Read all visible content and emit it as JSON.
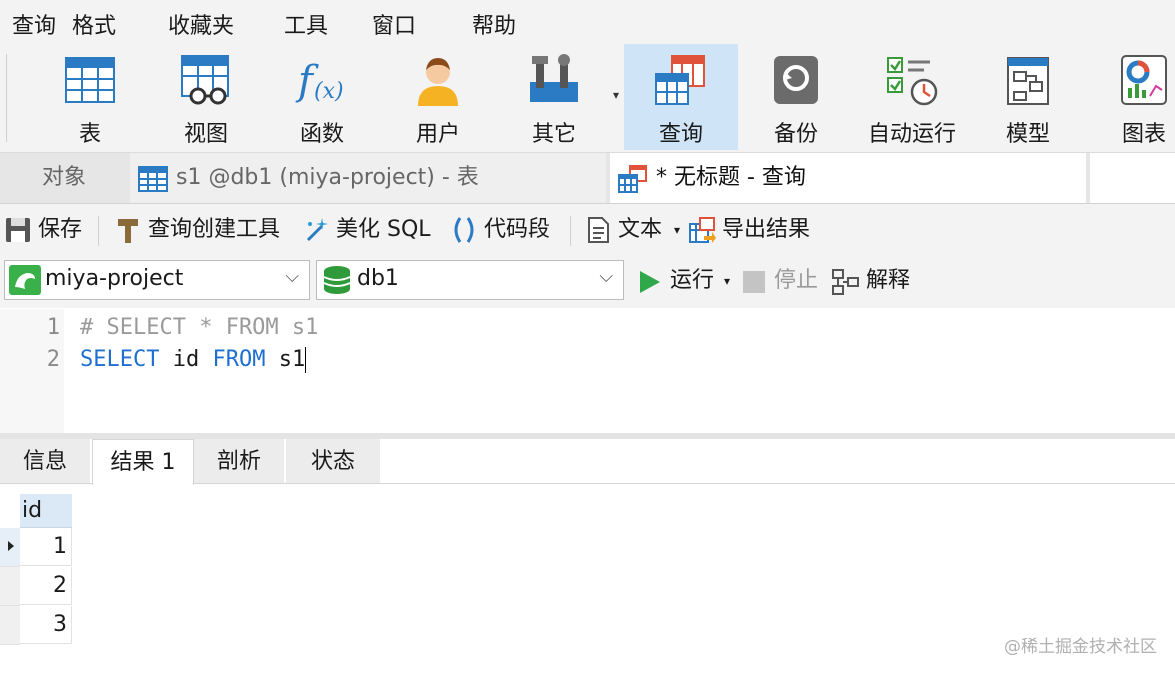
{
  "menu": [
    "查询",
    "格式",
    "收藏夹",
    "工具",
    "窗口",
    "帮助"
  ],
  "toolbar": {
    "buttons": [
      {
        "label": "表",
        "icon": "table-icon"
      },
      {
        "label": "视图",
        "icon": "view-icon"
      },
      {
        "label": "函数",
        "icon": "function-icon"
      },
      {
        "label": "用户",
        "icon": "user-icon"
      },
      {
        "label": "其它",
        "icon": "tools-icon"
      },
      {
        "label": "查询",
        "icon": "query-icon",
        "active": true
      },
      {
        "label": "备份",
        "icon": "backup-icon"
      },
      {
        "label": "自动运行",
        "icon": "autorun-icon"
      },
      {
        "label": "模型",
        "icon": "model-icon"
      },
      {
        "label": "图表",
        "icon": "chart-icon"
      }
    ]
  },
  "tabs": {
    "objects": "对象",
    "tab1": "s1 @db1 (miya-project) - 表",
    "tab2": "* 无标题 - 查询"
  },
  "query_toolbar": {
    "save": "保存",
    "query_builder": "查询创建工具",
    "beautify": "美化 SQL",
    "snippet": "代码段",
    "text": "文本",
    "export": "导出结果"
  },
  "selectors": {
    "connection": "miya-project",
    "database": "db1",
    "run": "运行",
    "stop": "停止",
    "explain": "解释"
  },
  "editor": {
    "lines": [
      {
        "num": "1",
        "text": "# SELECT * FROM s1"
      },
      {
        "num": "2",
        "kw1": "SELECT",
        "col": "id",
        "kw2": "FROM",
        "tbl": "s1"
      }
    ]
  },
  "result_tabs": [
    "信息",
    "结果 1",
    "剖析",
    "状态"
  ],
  "grid": {
    "column": "id",
    "rows": [
      "1",
      "2",
      "3"
    ]
  },
  "watermark": "@稀土掘金技术社区",
  "colors": {
    "accent": "#1f6fd1",
    "active_tab": "#cfe5f7"
  }
}
